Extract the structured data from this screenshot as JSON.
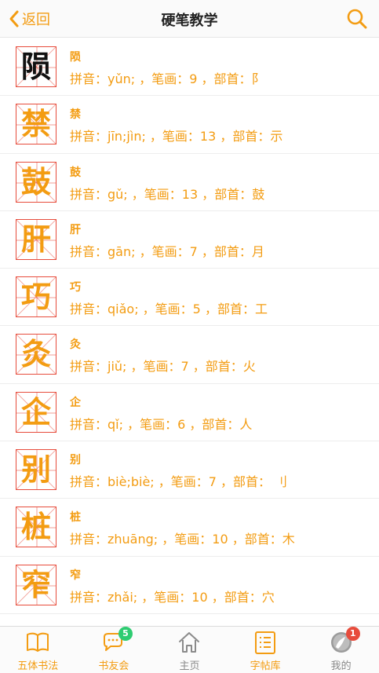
{
  "header": {
    "back_label": "返回",
    "title": "硬笔教学"
  },
  "colors": {
    "accent": "#f39c12",
    "grid_red": "#e74c3c",
    "badge_green": "#2ecc71",
    "badge_red": "#e74c3c"
  },
  "characters": [
    {
      "char": "陨",
      "name": "陨",
      "info": "拼音：yǔn; ，笔画：9 ，部首：阝"
    },
    {
      "char": "禁",
      "name": "禁",
      "info": "拼音：jīn;jìn; ，笔画：13 ，部首：示"
    },
    {
      "char": "鼓",
      "name": "鼓",
      "info": "拼音：gǔ; ，笔画：13 ，部首：鼓"
    },
    {
      "char": "肝",
      "name": "肝",
      "info": "拼音：gān; ，笔画：7 ，部首：月"
    },
    {
      "char": "巧",
      "name": "巧",
      "info": "拼音：qiǎo; ，笔画：5 ，部首：工"
    },
    {
      "char": "灸",
      "name": "灸",
      "info": "拼音：jiǔ; ，笔画：7 ，部首：火"
    },
    {
      "char": "企",
      "name": "企",
      "info": "拼音：qǐ; ，笔画：6 ，部首：人"
    },
    {
      "char": "别",
      "name": "别",
      "info": "拼音：biè;biè; ，笔画：7 ，部首： 刂"
    },
    {
      "char": "桩",
      "name": "桩",
      "info": "拼音：zhuāng; ，笔画：10 ，部首：木"
    },
    {
      "char": "窄",
      "name": "窄",
      "info": "拼音：zhǎi; ，笔画：10 ，部首：穴"
    }
  ],
  "tabs": [
    {
      "label": "五体书法",
      "icon": "book-icon"
    },
    {
      "label": "书友会",
      "icon": "chat-bubble-icon",
      "badge": "5"
    },
    {
      "label": "主页",
      "icon": "home-icon"
    },
    {
      "label": "字帖库",
      "icon": "list-icon"
    },
    {
      "label": "我的",
      "icon": "avatar-icon",
      "badge": "1"
    }
  ]
}
